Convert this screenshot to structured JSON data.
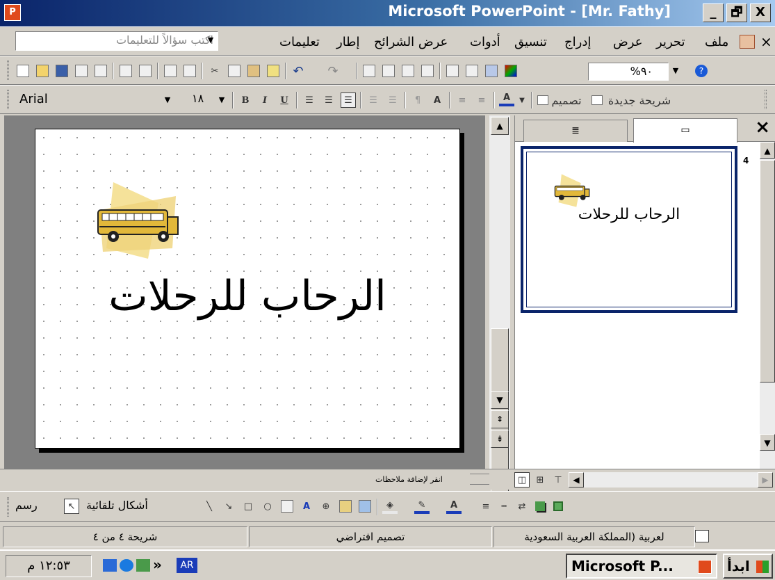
{
  "window": {
    "title": "Microsoft PowerPoint - [Mr. Fathy]",
    "app_icon": "powerpoint-icon",
    "controls": [
      "_",
      "🗗",
      "X"
    ]
  },
  "menubar": {
    "items": [
      "ملف",
      "تحرير",
      "عرض",
      "إدراج",
      "تنسيق",
      "أدوات",
      "عرض الشرائح",
      "إطار",
      "تعليمات"
    ],
    "help_placeholder": "اكتب سؤالاً للتعليمات",
    "close": "×"
  },
  "toolbar": {
    "zoom": "%٩٠"
  },
  "format_toolbar": {
    "font_name": "Arial",
    "font_size": "١٨",
    "new_slide": "شريحة جديدة",
    "design": "تصميم",
    "bold": "B",
    "italic": "I",
    "underline": "U",
    "font_color": "A",
    "grow": "A"
  },
  "slide": {
    "title": "الرحاب للرحلات",
    "image": "school-bus-icon"
  },
  "task_pane": {
    "outline_tab_icon": "outline-icon",
    "slides_tab_icon": "slides-icon",
    "close": "×",
    "thumbnail": {
      "number": "4",
      "title": "الرحاب للرحلات"
    }
  },
  "notes": {
    "placeholder": "انقر لإضافة ملاحظات"
  },
  "drawing_toolbar": {
    "draw": "رسم",
    "autoshapes": "أشكال تلقائية"
  },
  "statusbar": {
    "slide": "شريحة ٤ من ٤",
    "design": "تصميم افتراضي",
    "language": "لعربية (المملكة العربية السعودية"
  },
  "taskbar": {
    "start": "ابدأ",
    "task": "Microsoft P...",
    "lang": "AR",
    "clock": "١٢:٥٣ م",
    "chevron": "»"
  }
}
